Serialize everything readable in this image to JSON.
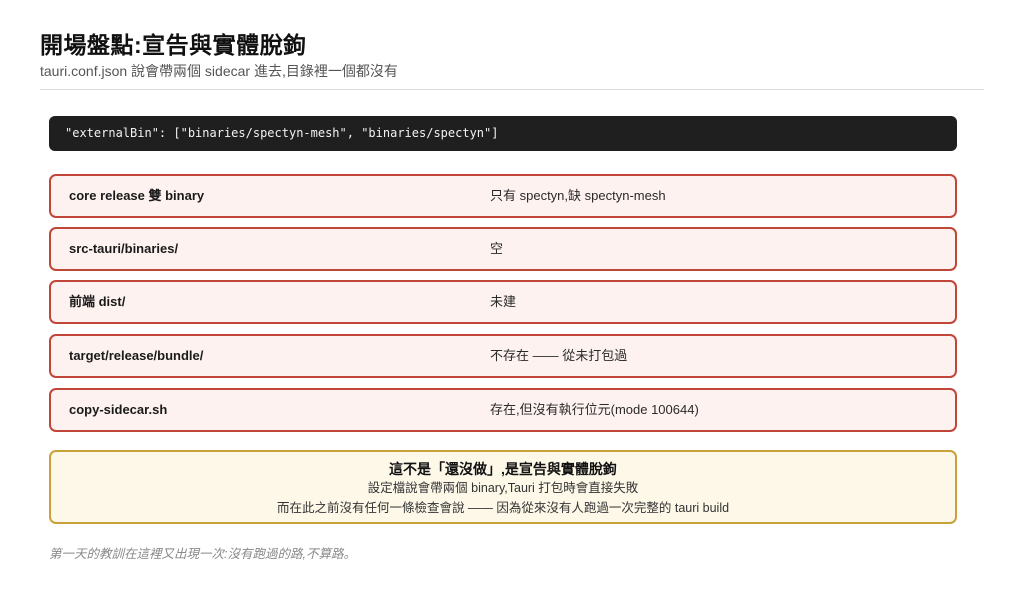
{
  "header": {
    "title": "開場盤點:宣告與實體脫鉤",
    "subtitle": "tauri.conf.json 說會帶兩個 sidecar 進去,目錄裡一個都沒有"
  },
  "code": {
    "text": "\"externalBin\": [\"binaries/spectyn-mesh\", \"binaries/spectyn\"]"
  },
  "rows": [
    {
      "label": "core release 雙 binary",
      "value": "只有 spectyn,缺 spectyn-mesh"
    },
    {
      "label": "src-tauri/binaries/",
      "value": "空"
    },
    {
      "label": "前端 dist/",
      "value": "未建"
    },
    {
      "label": "target/release/bundle/",
      "value": "不存在 —— 從未打包過"
    },
    {
      "label": "copy-sidecar.sh",
      "value": "存在,但沒有執行位元(mode 100644)"
    }
  ],
  "note": {
    "heading": "這不是「還沒做」,是宣告與實體脫鉤",
    "line1": "設定檔說會帶兩個 binary,Tauri 打包時會直接失敗",
    "line2": "而在此之前沒有任何一條檢查會說 —— 因為從來沒有人跑過一次完整的 tauri build"
  },
  "footer": {
    "text": "第一天的教訓在這裡又出現一次:沒有跑過的路,不算路。"
  },
  "colors": {
    "code_bg": "#1f1f1f",
    "row_border": "#c0463a",
    "row_bg": "#fdf2f0",
    "note_border": "#c9a13a",
    "note_bg": "#fdf8e8"
  }
}
